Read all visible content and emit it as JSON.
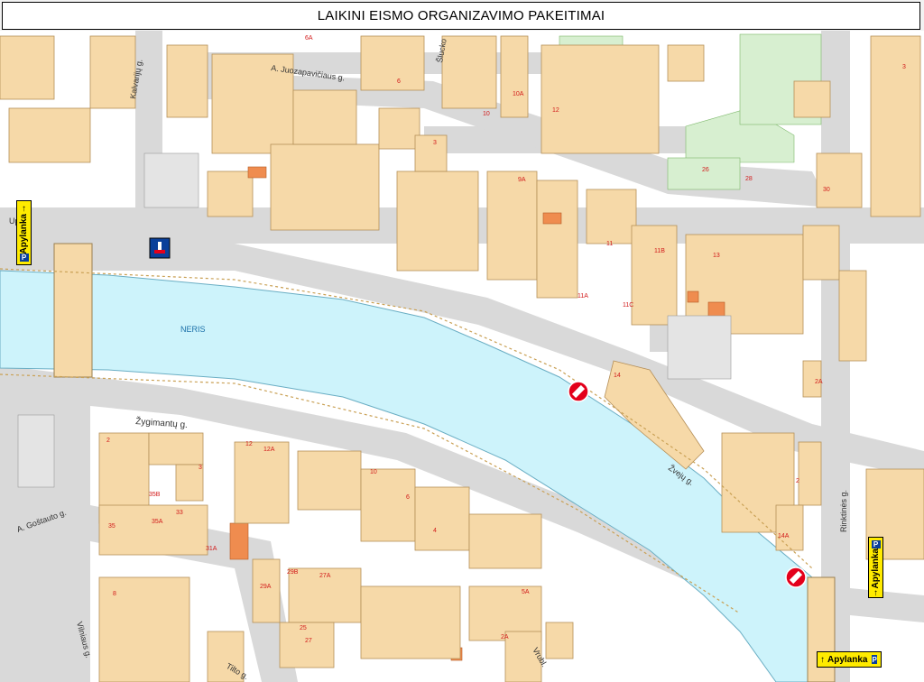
{
  "title": "LAIKINI EISMO ORGANIZAVIMO PAKEITIMAI",
  "river_label": "NERIS",
  "streets": {
    "juozapaviciaus": "A. Juozapavičiaus g.",
    "kalvariju": "Kalvarijų g.",
    "upe": "Upė",
    "sluckio": "Šlucko",
    "zygimantu": "Žygimantų g.",
    "zvejus": "Žvejų g.",
    "rinktines": "Rinktinės g.",
    "gostauto": "A. Goštauto g.",
    "vilniaus": "Vilniaus g.",
    "tilto": "Tilto g.",
    "ziedo": "Vrubl."
  },
  "house_numbers": [
    "6A",
    "6",
    "10",
    "10A",
    "12",
    "3",
    "26",
    "28",
    "30",
    "9A",
    "11",
    "11B",
    "13",
    "11A",
    "11C",
    "14",
    "2A",
    "2",
    "14A",
    "8",
    "3",
    "2",
    "12",
    "12A",
    "10",
    "6",
    "4",
    "35B",
    "35",
    "33",
    "35A",
    "31A",
    "29A",
    "29B",
    "27A",
    "25",
    "27",
    "2A",
    "5A",
    "3"
  ],
  "signs": {
    "apylanka_left": "Apylanka",
    "apylanka_right": "Apylanka",
    "apylanka_bottom": "Apylanka",
    "arrow": "↑",
    "parking": "P"
  },
  "colors": {
    "river": "#cdf3fb",
    "building": "#f6d9a8",
    "road": "#d9d9d9",
    "block": "#ffffff",
    "green": "#d7efd0",
    "no_entry": "#e3001b",
    "sign_yellow": "#ffeb00",
    "sign_blue": "#0a3f9a"
  }
}
